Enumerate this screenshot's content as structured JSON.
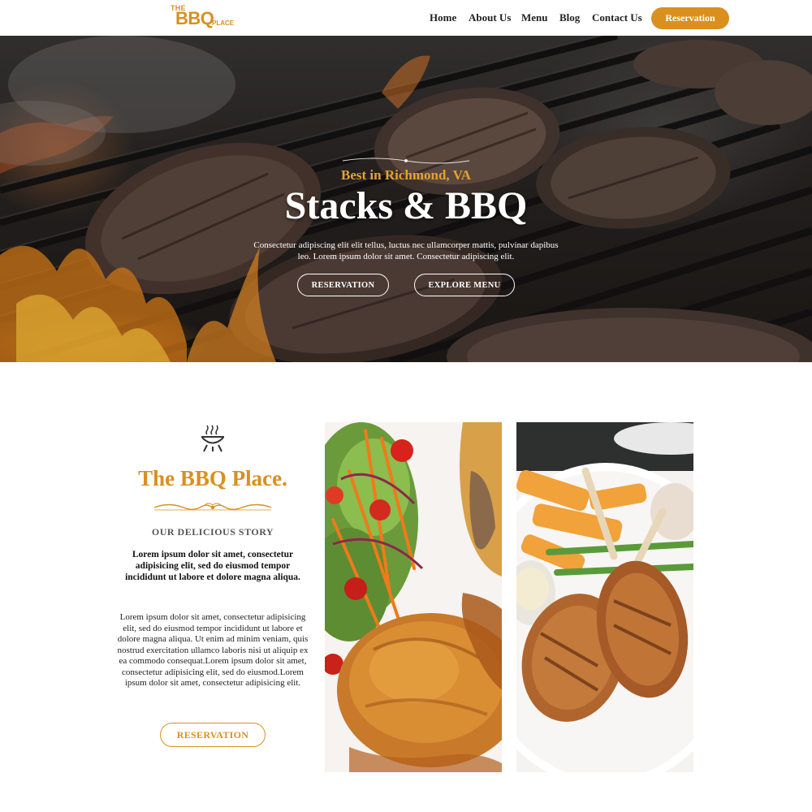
{
  "header": {
    "logo": {
      "the": "THE",
      "bbq": "BBQ",
      "place": "PLACE"
    },
    "nav": [
      {
        "label": "Home"
      },
      {
        "label": "About Us"
      },
      {
        "label": "Menu"
      },
      {
        "label": "Blog"
      },
      {
        "label": "Contact Us"
      }
    ],
    "reservation_label": "Reservation"
  },
  "hero": {
    "tagline": "Best in Richmond, VA",
    "title": "Stacks & BBQ",
    "text": "Consectetur adipiscing elit elit tellus, luctus nec ullamcorper mattis, pulvinar dapibus leo. Lorem ipsum dolor sit amet. Consectetur adipiscing elit.",
    "reservation_button": "RESERVATION",
    "explore_button": "EXPLORE MENU"
  },
  "story": {
    "title": "The BBQ Place.",
    "subtitle": "OUR DELICIOUS STORY",
    "bold_text": "Lorem ipsum dolor sit amet, consectetur adipisicing elit, sed do eiusmod tempor incididunt ut labore et dolore magna aliqua.",
    "body_text": "Lorem ipsum dolor sit amet, consectetur adipisicing elit, sed do eiusmod tempor incididunt ut labore et dolore magna aliqua. Ut enim ad minim veniam, quis nostrud exercitation ullamco laboris nisi ut aliquip ex ea commodo consequat.Lorem ipsum dolor sit amet, consectetur adipisicing elit, sed do eiusmod.Lorem ipsum dolor sit amet, consectetur adipisicing elit.",
    "button": "RESERVATION"
  },
  "colors": {
    "accent": "#d9901f",
    "text": "#222222",
    "white": "#ffffff"
  },
  "icons": [
    "grill-icon",
    "flourish-divider"
  ]
}
